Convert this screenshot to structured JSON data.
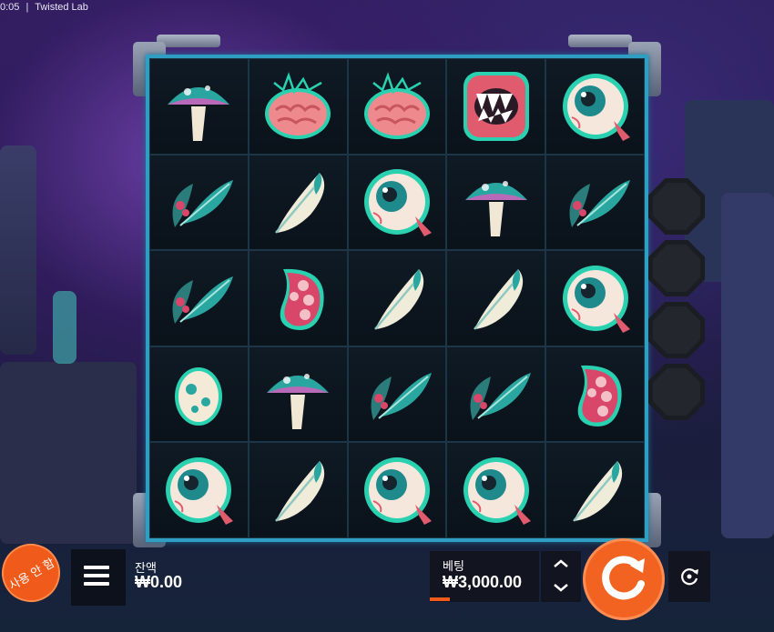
{
  "title_bar": {
    "time": "0:05",
    "separator": "|",
    "app_title": "Twisted Lab"
  },
  "grid": [
    [
      "mushroom",
      "brain",
      "brain",
      "mouth",
      "eyeball"
    ],
    [
      "leaf",
      "feather",
      "eyeball",
      "mushroom",
      "leaf"
    ],
    [
      "leaf",
      "tentacle",
      "feather",
      "feather",
      "eyeball"
    ],
    [
      "egg",
      "mushroom",
      "leaf",
      "leaf",
      "tentacle"
    ],
    [
      "eyeball",
      "feather",
      "eyeball",
      "eyeball",
      "feather"
    ]
  ],
  "controls": {
    "guide_label": "사용 안 함",
    "balance_label": "잔액",
    "balance_value": "₩0.00",
    "bet_label": "베팅",
    "bet_value": "₩3,000.00",
    "stepper_up": "⌃",
    "stepper_down": "⌄"
  },
  "colors": {
    "accent": "#f26322",
    "reel_border": "#2e9ec2",
    "symbol_teal": "#2aa6a0",
    "symbol_pink": "#e8747e"
  }
}
